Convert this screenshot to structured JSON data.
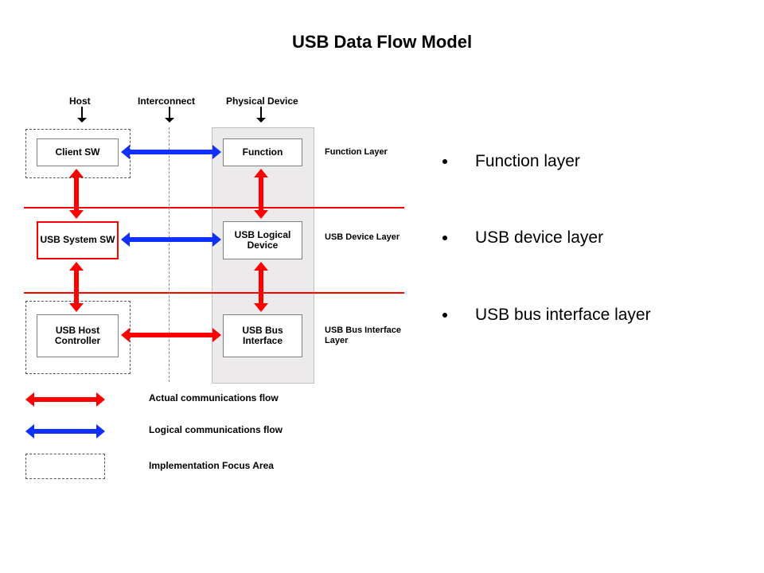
{
  "title": "USB Data Flow Model",
  "bullets": [
    "Function layer",
    "USB device layer",
    "USB bus interface layer"
  ],
  "columns": {
    "host": "Host",
    "interconnect": "Interconnect",
    "physical_device": "Physical Device"
  },
  "blocks": {
    "client_sw": "Client SW",
    "function": "Function",
    "usb_system_sw": "USB System SW",
    "usb_logical_device": "USB Logical Device",
    "usb_host_controller": "USB Host Controller",
    "usb_bus_interface": "USB Bus Interface"
  },
  "layers": {
    "function": "Function Layer",
    "device": "USB Device Layer",
    "bus": "USB Bus Interface Layer"
  },
  "legend": {
    "actual": "Actual communications flow",
    "logical": "Logical communications flow",
    "focus": "Implementation Focus Area"
  }
}
